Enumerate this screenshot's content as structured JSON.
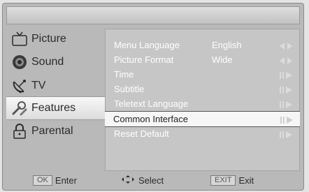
{
  "sidebar": {
    "items": [
      {
        "label": "Picture",
        "icon": "tv-icon"
      },
      {
        "label": "Sound",
        "icon": "speaker-icon"
      },
      {
        "label": "TV",
        "icon": "satellite-dish-icon"
      },
      {
        "label": "Features",
        "icon": "tools-icon"
      },
      {
        "label": "Parental",
        "icon": "lock-icon"
      }
    ],
    "selected_index": 3
  },
  "menu": {
    "rows": [
      {
        "label": "Menu Language",
        "value": "English"
      },
      {
        "label": "Picture Format",
        "value": "Wide"
      },
      {
        "label": "Time",
        "value": ""
      },
      {
        "label": "Subtitle",
        "value": ""
      },
      {
        "label": "Teletext Language",
        "value": ""
      },
      {
        "label": "Common Interface",
        "value": ""
      },
      {
        "label": "Reset Default",
        "value": ""
      }
    ],
    "selected_index": 5
  },
  "footer": {
    "enter_key": "OK",
    "enter_label": "Enter",
    "select_label": "Select",
    "exit_key": "EXIT",
    "exit_label": "Exit"
  }
}
